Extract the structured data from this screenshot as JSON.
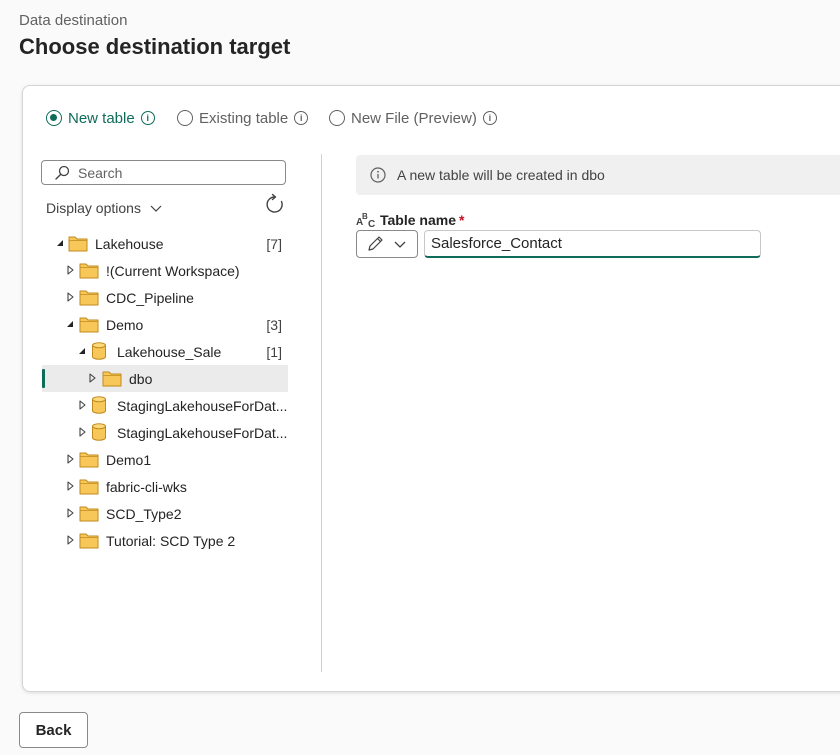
{
  "header": {
    "subtitle": "Data destination",
    "title": "Choose destination target"
  },
  "options": {
    "new_table": "New table",
    "existing_table": "Existing table",
    "new_file": "New File (Preview)",
    "selected": "new_table"
  },
  "sidebar": {
    "search_placeholder": "Search",
    "display_options": "Display options",
    "tree": [
      {
        "label": "Lakehouse",
        "count": "[7]",
        "type": "folder",
        "expanded": true,
        "depth": 0
      },
      {
        "label": "!(Current Workspace)",
        "count": "",
        "type": "folder",
        "expanded": false,
        "depth": 1
      },
      {
        "label": "CDC_Pipeline",
        "count": "",
        "type": "folder",
        "expanded": false,
        "depth": 1
      },
      {
        "label": "Demo",
        "count": "[3]",
        "type": "folder",
        "expanded": true,
        "depth": 1
      },
      {
        "label": "Lakehouse_Sale",
        "count": "[1]",
        "type": "database",
        "expanded": true,
        "depth": 2
      },
      {
        "label": "dbo",
        "count": "",
        "type": "folder",
        "expanded": false,
        "depth": 3,
        "selected": true
      },
      {
        "label": "StagingLakehouseForDat...",
        "count": "",
        "type": "database",
        "expanded": false,
        "depth": 2
      },
      {
        "label": "StagingLakehouseForDat...",
        "count": "",
        "type": "database",
        "expanded": false,
        "depth": 2
      },
      {
        "label": "Demo1",
        "count": "",
        "type": "folder",
        "expanded": false,
        "depth": 1
      },
      {
        "label": "fabric-cli-wks",
        "count": "",
        "type": "folder",
        "expanded": false,
        "depth": 1
      },
      {
        "label": "SCD_Type2",
        "count": "",
        "type": "folder",
        "expanded": false,
        "depth": 1
      },
      {
        "label": "Tutorial: SCD Type 2",
        "count": "",
        "type": "folder",
        "expanded": false,
        "depth": 1
      }
    ]
  },
  "main": {
    "info_banner": "A new table will be created in dbo",
    "table_name_label": "Table name",
    "required_marker": "*",
    "table_name_value": "Salesforce_Contact"
  },
  "footer": {
    "back_label": "Back"
  },
  "colors": {
    "accent": "#0f6c5a",
    "folder": "#f7c859",
    "required": "#c50f1f"
  }
}
